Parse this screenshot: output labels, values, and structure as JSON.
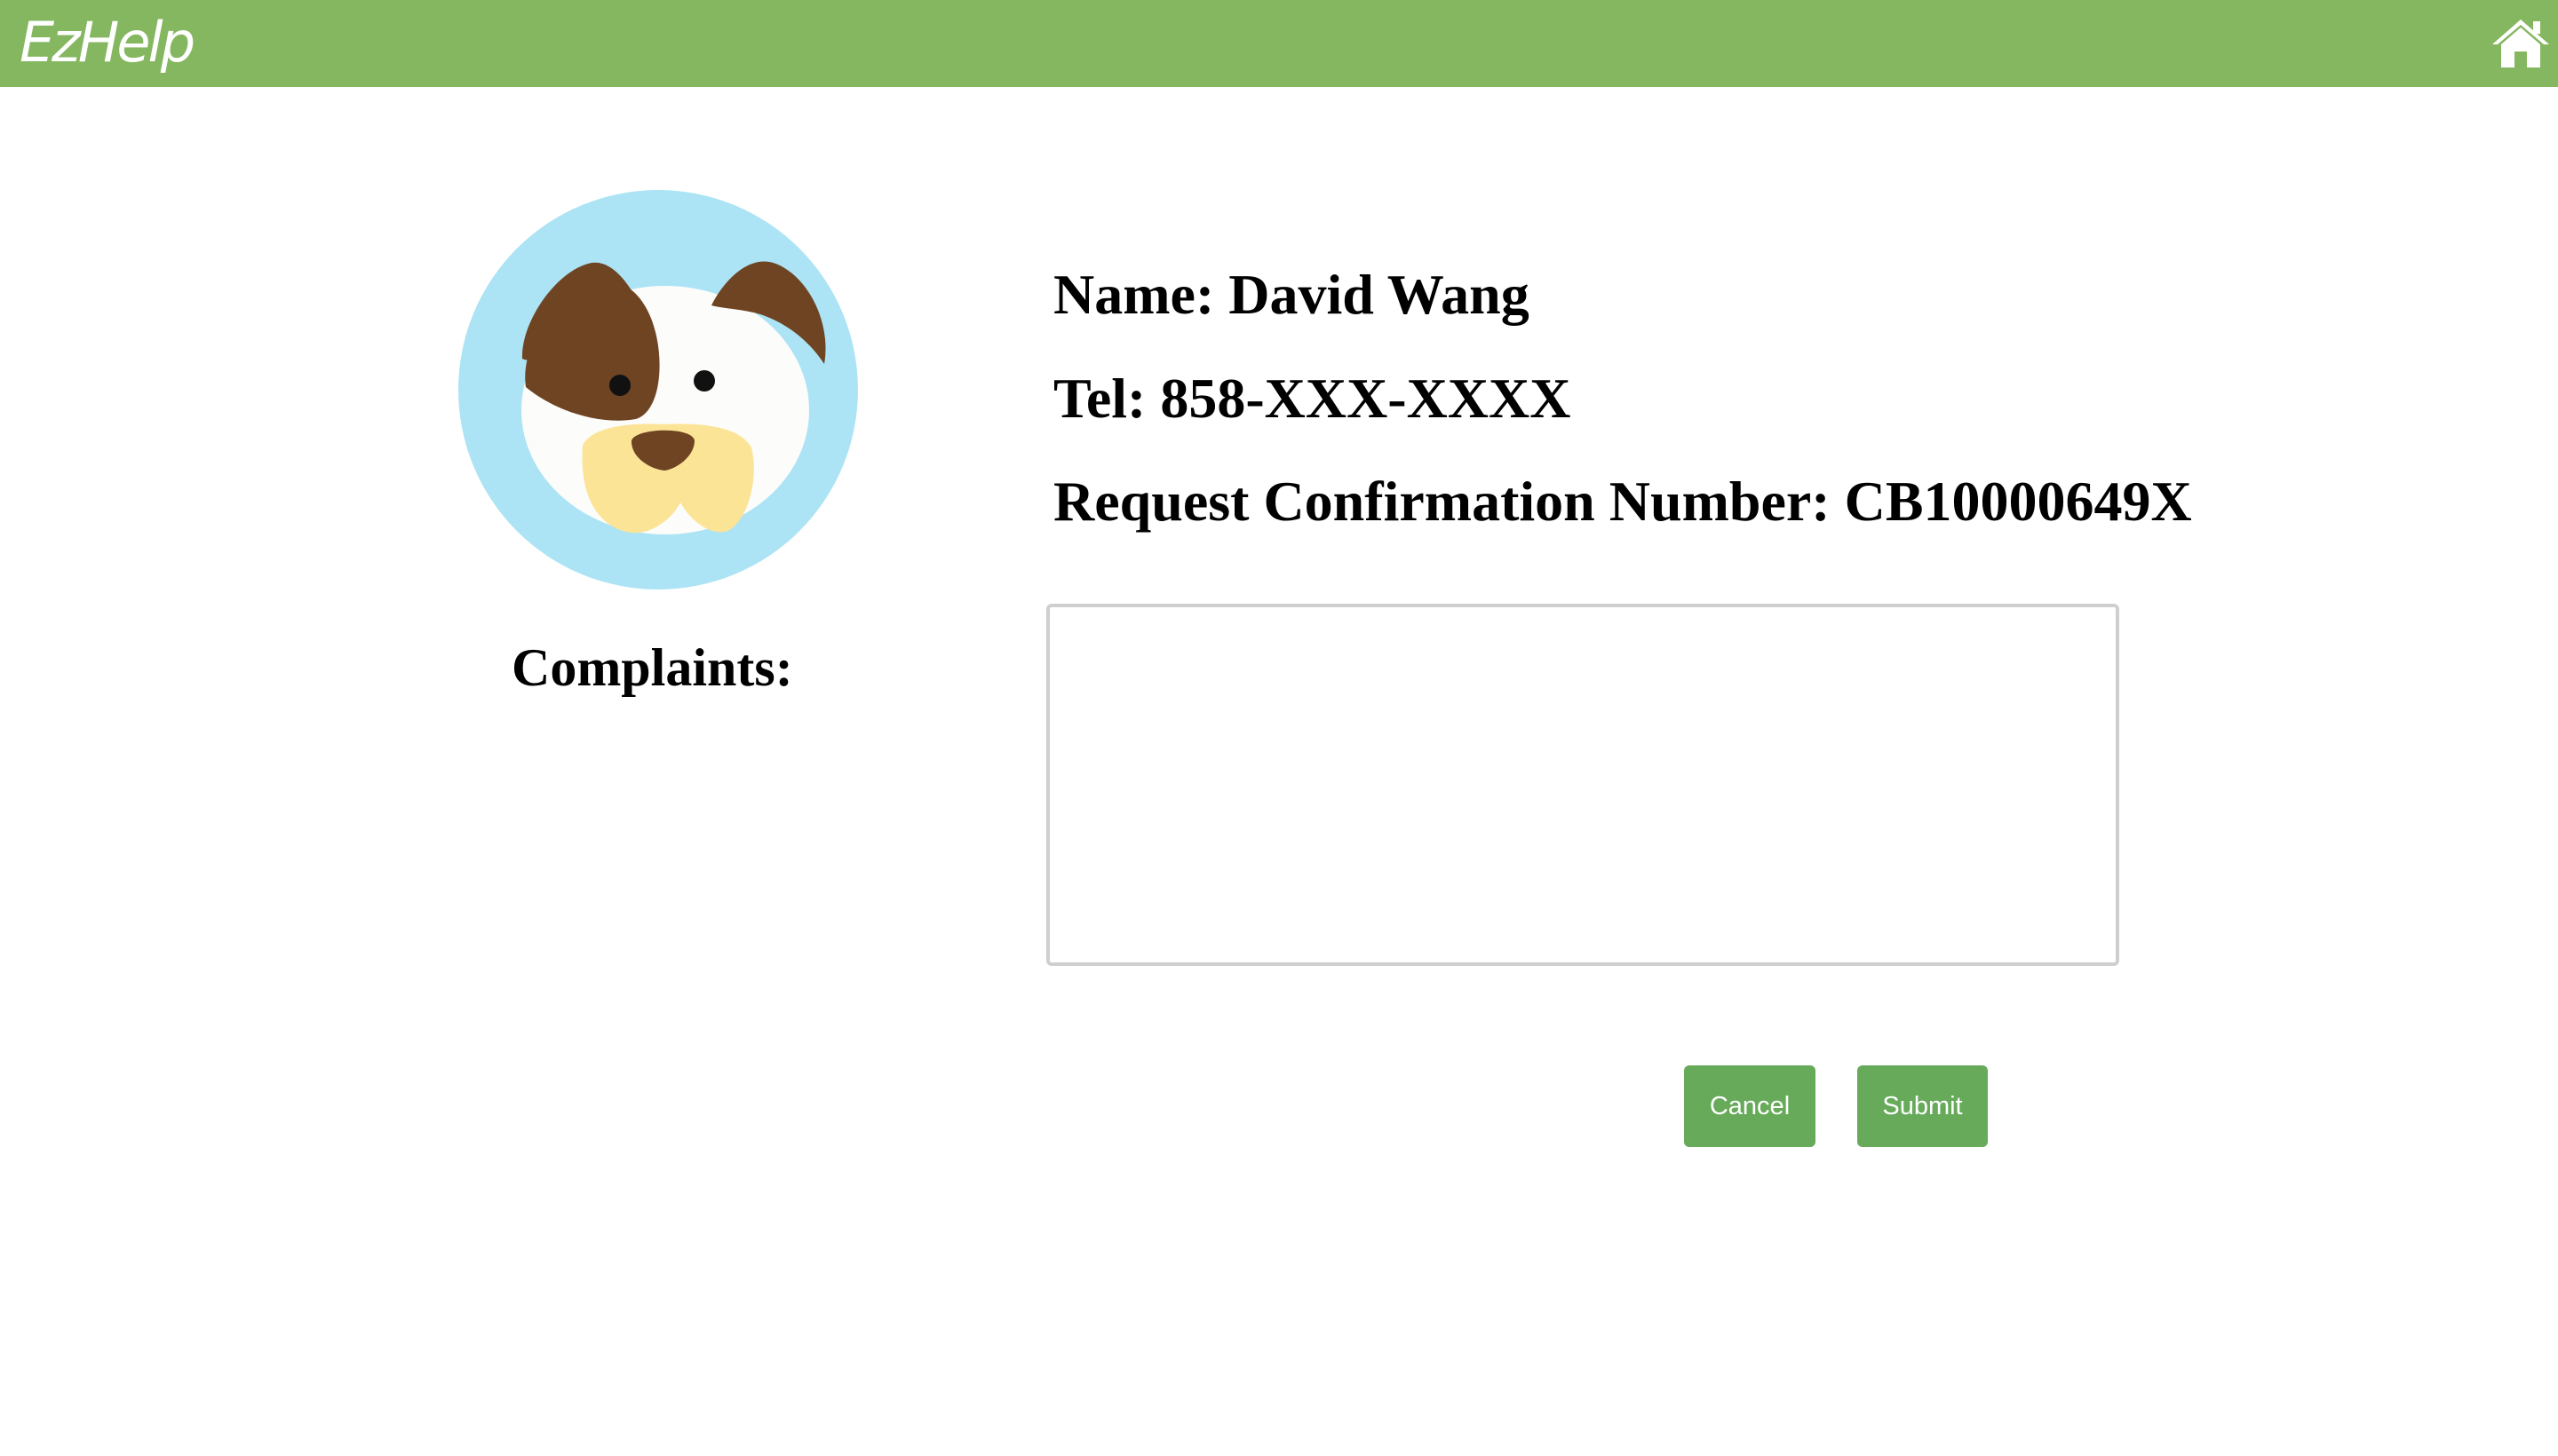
{
  "header": {
    "logo": "EzHelp",
    "home_icon": "home-icon",
    "bar_color": "#85b761"
  },
  "profile": {
    "avatar_icon": "dog-avatar-icon",
    "name": "Name: David Wang",
    "tel": "Tel: 858-XXX-XXXX",
    "confirmation": "Request Confirmation Number: CB10000649X"
  },
  "complaints": {
    "label": "Complaints:",
    "value": "",
    "placeholder": ""
  },
  "actions": {
    "cancel_label": "Cancel",
    "submit_label": "Submit",
    "button_color": "#66aa5a"
  }
}
